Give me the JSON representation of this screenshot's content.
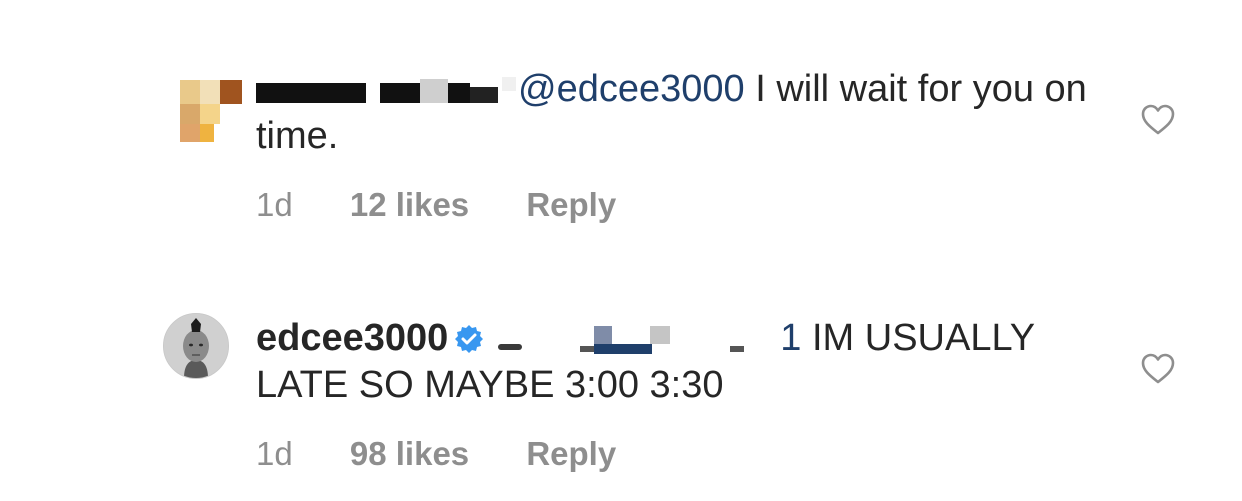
{
  "comments": [
    {
      "mention": "@edcee3000",
      "text": " I will wait for you on time.",
      "time": "1d",
      "likes": "12 likes",
      "reply": "Reply"
    },
    {
      "username": "edcee3000",
      "mention_tail": "1",
      "text": " IM USUALLY LATE SO MAYBE 3:00 3:30",
      "time": "1d",
      "likes": "98 likes",
      "reply": "Reply"
    }
  ],
  "icons": {
    "like": "heart-outline-icon",
    "verified": "verified-badge-icon"
  },
  "colors": {
    "mention": "#1f3f6b",
    "meta": "#8e8e8e",
    "verified": "#3897f0"
  }
}
